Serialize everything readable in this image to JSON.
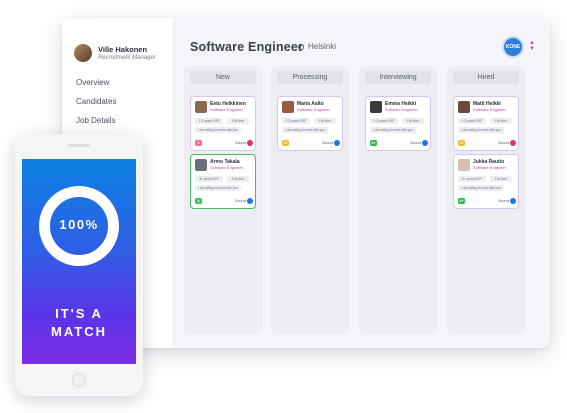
{
  "user": {
    "name": "Ville Hakonen",
    "role": "Recruitment Manager"
  },
  "nav": [
    "Overview",
    "Candidates",
    "Job Details"
  ],
  "job": {
    "title": "Software Engineer",
    "location": "Helsinki"
  },
  "brand": {
    "logo_text": "KONE"
  },
  "columns": [
    {
      "label": "New",
      "cards": [
        {
          "name": "Eetu Heikkinen",
          "role": "Software Engineer",
          "exp": "1-3 years EXP",
          "type": "Full-time",
          "note": "I am willing to work with you",
          "badge": "C",
          "badge_color": "#f06a8a",
          "source": "Source",
          "source_icon": "instagram-icon",
          "source_color": "#e1306c",
          "avatar_color": "#8a6a50",
          "highlight": false
        },
        {
          "name": "Armo Takala",
          "role": "Software Engineer",
          "exp": "3+ years EXP",
          "type": "Full-time",
          "note": "I am willing to work with you",
          "badge": "A",
          "badge_color": "#3fbf62",
          "source": "Source",
          "source_icon": "facebook-icon",
          "source_color": "#1877f2",
          "avatar_color": "#6a6e78",
          "highlight": true
        }
      ]
    },
    {
      "label": "Processing",
      "cards": [
        {
          "name": "Maria Aalto",
          "role": "Software Engineer",
          "exp": "1-3 years EXP",
          "type": "Full-time",
          "note": "I am willing to work with you",
          "badge": "B",
          "badge_color": "#f5b82e",
          "source": "Source",
          "source_icon": "facebook-icon",
          "source_color": "#1877f2",
          "avatar_color": "#9a5a40",
          "highlight": false
        }
      ]
    },
    {
      "label": "Interviewing",
      "cards": [
        {
          "name": "Emma Heikki",
          "role": "Software Engineer",
          "exp": "1-3 years EXP",
          "type": "Full-time",
          "note": "I am willing to work with you",
          "badge": "A+",
          "badge_color": "#2fb84a",
          "source": "Source",
          "source_icon": "facebook-icon",
          "source_color": "#1877f2",
          "avatar_color": "#3a3a3a",
          "highlight": false
        }
      ]
    },
    {
      "label": "Hired",
      "cards": [
        {
          "name": "Matti Heikki",
          "role": "Software Engineer",
          "exp": "1-3 years EXP",
          "type": "Full-time",
          "note": "I am willing to work with you",
          "badge": "B",
          "badge_color": "#f5b82e",
          "source": "Source",
          "source_icon": "instagram-icon",
          "source_color": "#e1306c",
          "avatar_color": "#6a4a3a",
          "highlight": false
        },
        {
          "name": "Jukka Rautio",
          "role": "Software Engineer",
          "exp": "3+ years EXP",
          "type": "Full-time",
          "note": "I am willing to work with you",
          "badge": "A+",
          "badge_color": "#2fb84a",
          "source": "Source",
          "source_icon": "facebook-icon",
          "source_color": "#1877f2",
          "avatar_color": "#d8c0b0",
          "highlight": false
        }
      ]
    }
  ],
  "phone": {
    "percent": "100%",
    "line1": "IT'S A",
    "line2": "MATCH",
    "progress": 1.0
  }
}
